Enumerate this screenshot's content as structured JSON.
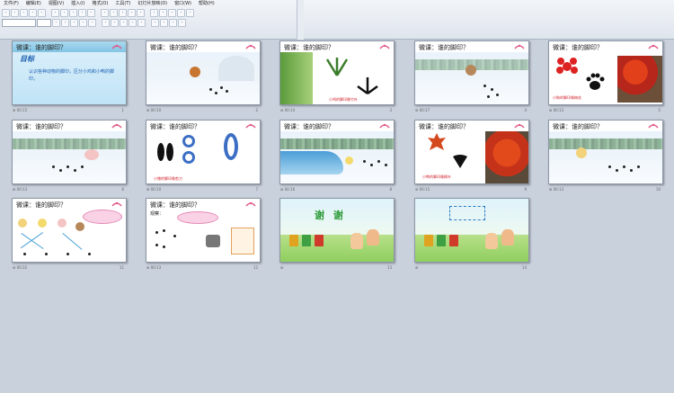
{
  "menubar": [
    "文件(F)",
    "编辑(E)",
    "视图(V)",
    "插入(I)",
    "格式(O)",
    "工具(T)",
    "幻灯片放映(D)",
    "窗口(W)",
    "帮助(H)"
  ],
  "toolbar": {
    "row1_icons": [
      "new-icon",
      "open-icon",
      "save-icon",
      "permission-icon",
      "email-icon",
      "print-icon",
      "preview-icon",
      "spell-icon",
      "cut-icon",
      "copy-icon",
      "paste-icon",
      "format-painter-icon",
      "undo-icon",
      "redo-icon",
      "hyperlink-icon",
      "table-icon",
      "chart-icon",
      "new-slide-icon",
      "zoom-icon",
      "help-icon"
    ],
    "row2_icons": [
      "bold-icon",
      "italic-icon",
      "underline-icon",
      "shadow-icon",
      "align-left-icon",
      "center-icon",
      "align-right-icon",
      "bullets-icon",
      "numbering-icon",
      "increase-font-icon",
      "decrease-font-icon",
      "font-color-icon",
      "design-icon",
      "new-slide-icon"
    ]
  },
  "slide_title": "微课：谁的脚印？",
  "slides": [
    {
      "num": "1",
      "title": "微课：谁的脚印？",
      "goal": "目标",
      "goal_text": "认识各种动物的脚印，区分小鸡和小鸭的脚印。"
    },
    {
      "num": "2",
      "title": "微课：谁的脚印？"
    },
    {
      "num": "3",
      "title": "微课：谁的脚印？",
      "caption": "小鸡的脚印像竹叶"
    },
    {
      "num": "4",
      "title": "微课：谁的脚印？"
    },
    {
      "num": "5",
      "title": "微课：谁的脚印？",
      "caption": "小狗的脚印像梅花"
    },
    {
      "num": "6",
      "title": "微课：谁的脚印？"
    },
    {
      "num": "7",
      "title": "微课：谁的脚印？",
      "caption": "小鸭的脚印像枫叶"
    },
    {
      "num": "8",
      "title": "微课：谁的脚印？"
    },
    {
      "num": "9",
      "title": "微课：谁的脚印？",
      "caption": "小鸭的脚印像枫叶"
    },
    {
      "num": "10",
      "title": "微课：谁的脚印？"
    },
    {
      "num": "11",
      "title": "微课：谁的脚印？"
    },
    {
      "num": "12",
      "title": "微课：谁的脚印？",
      "caption": "观察："
    },
    {
      "num": "13",
      "thanks": "谢 谢"
    },
    {
      "num": "14"
    }
  ],
  "colors": {
    "accent": "#1b5fb0",
    "caption_red": "#d0212a",
    "background": "#c9d1dc"
  }
}
